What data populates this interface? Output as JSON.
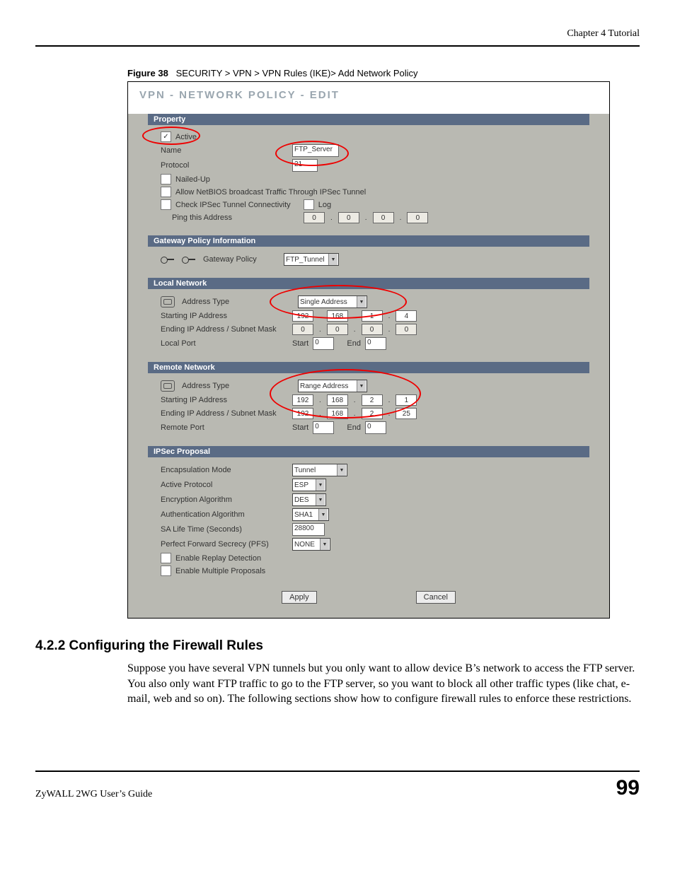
{
  "header": {
    "chapter": "Chapter 4 Tutorial"
  },
  "figure": {
    "label": "Figure 38",
    "caption": "SECURITY > VPN > VPN Rules (IKE)> Add Network Policy"
  },
  "panel": {
    "title": "VPN - NETWORK POLICY - EDIT",
    "sections": {
      "property": {
        "bar": "Property",
        "active_label": "Active",
        "active_checked": "✓",
        "name_label": "Name",
        "name_value": "FTP_Server",
        "protocol_label": "Protocol",
        "protocol_value": "21",
        "nailed_label": "Nailed-Up",
        "netbios_label": "Allow NetBIOS broadcast Traffic Through IPSec Tunnel",
        "checkconn_label": "Check IPSec Tunnel Connectivity",
        "log_label": "Log",
        "ping_label": "Ping this Address",
        "ping_ip": [
          "0",
          "0",
          "0",
          "0"
        ]
      },
      "gateway": {
        "bar": "Gateway Policy Information",
        "label": "Gateway Policy",
        "value": "FTP_Tunnel"
      },
      "local": {
        "bar": "Local Network",
        "addrtype_label": "Address Type",
        "addrtype_value": "Single Address",
        "start_label": "Starting IP Address",
        "start_ip": [
          "192",
          "168",
          "1",
          "4"
        ],
        "end_label": "Ending IP Address / Subnet Mask",
        "end_ip": [
          "0",
          "0",
          "0",
          "0"
        ],
        "localport_label": "Local Port",
        "start_txt": "Start",
        "end_txt": "End",
        "start_v": "0",
        "end_v": "0"
      },
      "remote": {
        "bar": "Remote Network",
        "addrtype_label": "Address Type",
        "addrtype_value": "Range Address",
        "start_label": "Starting IP Address",
        "start_ip": [
          "192",
          "168",
          "2",
          "1"
        ],
        "end_label": "Ending IP Address / Subnet Mask",
        "end_ip": [
          "192",
          "168",
          "2",
          "25"
        ],
        "remoteport_label": "Remote Port",
        "start_txt": "Start",
        "end_txt": "End",
        "start_v": "0",
        "end_v": "0"
      },
      "ipsec": {
        "bar": "IPSec Proposal",
        "encap_label": "Encapsulation Mode",
        "encap_value": "Tunnel",
        "proto_label": "Active Protocol",
        "proto_value": "ESP",
        "encr_label": "Encryption Algorithm",
        "encr_value": "DES",
        "auth_label": "Authentication Algorithm",
        "auth_value": "SHA1",
        "salife_label": "SA Life Time (Seconds)",
        "salife_value": "28800",
        "pfs_label": "Perfect Forward Secrecy (PFS)",
        "pfs_value": "NONE",
        "replay_label": "Enable Replay Detection",
        "multi_label": "Enable Multiple Proposals"
      }
    },
    "buttons": {
      "apply": "Apply",
      "cancel": "Cancel"
    }
  },
  "section": {
    "number_title": "4.2.2  Configuring the Firewall Rules",
    "para": "Suppose you have several VPN tunnels but you only want to allow device B’s network to access the FTP server. You also only want FTP traffic to go to the FTP server, so you want to block all other traffic types (like chat, e-mail, web and so on). The following sections show how to configure firewall rules to enforce these restrictions."
  },
  "footer": {
    "guide": "ZyWALL 2WG User’s Guide",
    "page": "99"
  }
}
